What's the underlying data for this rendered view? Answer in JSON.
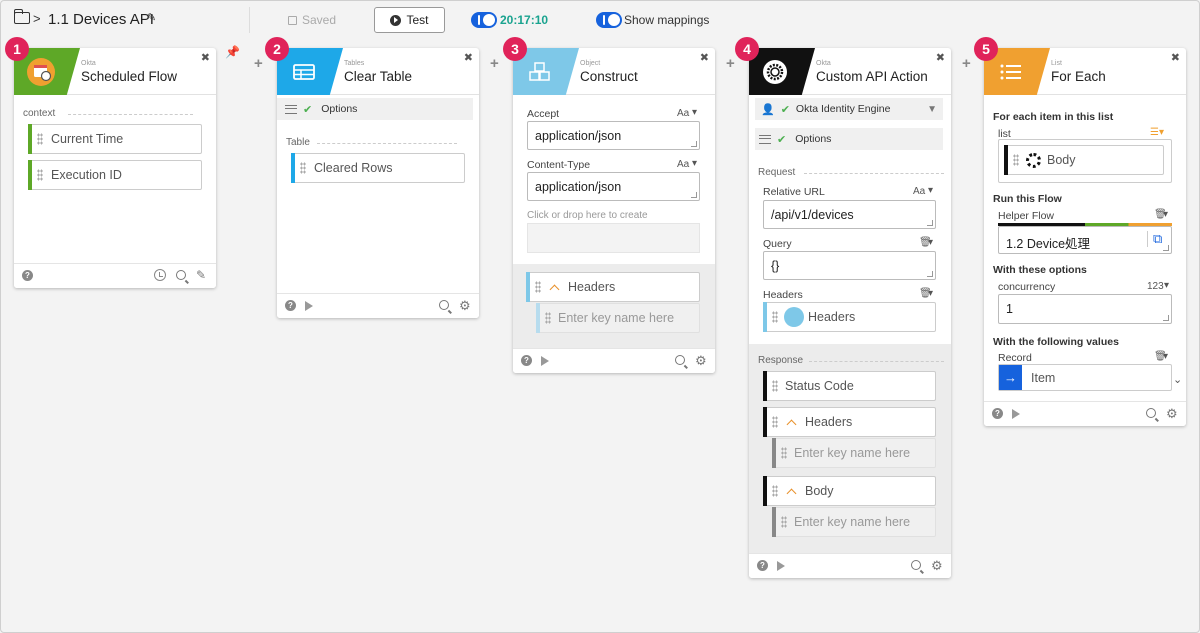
{
  "header": {
    "flow_name": "1.1 Devices API",
    "saved_label": "Saved",
    "test_label": "Test",
    "time": "20:17:10",
    "show_mappings_label": "Show mappings"
  },
  "colors": {
    "badge": "#e0235a",
    "okta_green": "#5ea827",
    "tables_blue": "#1ea8e8",
    "object_blue": "#7ec8e8",
    "okta_black": "#111111",
    "list_orange": "#f0a030",
    "time_teal": "#1aa38f",
    "toggle_blue": "#1662dd"
  },
  "cards": {
    "c1": {
      "step": "1",
      "category": "Okta",
      "title": "Scheduled Flow",
      "section_label": "context",
      "tokens": [
        "Current Time",
        "Execution ID"
      ],
      "icon": "calendar-clock-icon"
    },
    "c2": {
      "step": "2",
      "category": "Tables",
      "title": "Clear Table",
      "options_label": "Options",
      "section_label": "Table",
      "tokens": [
        "Cleared Rows"
      ],
      "icon": "table-icon"
    },
    "c3": {
      "step": "3",
      "category": "Object",
      "title": "Construct",
      "fields": [
        {
          "label": "Accept",
          "type": "Aa",
          "value": "application/json"
        },
        {
          "label": "Content-Type",
          "type": "Aa",
          "value": "application/json"
        }
      ],
      "drop_hint": "Click or drop here to create",
      "headers_label": "Headers",
      "key_placeholder": "Enter key name here",
      "icon": "cubes-icon"
    },
    "c4": {
      "step": "4",
      "category": "Okta",
      "title": "Custom API Action",
      "connection": "Okta Identity Engine",
      "options_label": "Options",
      "request_label": "Request",
      "fields": [
        {
          "label": "Relative URL",
          "type": "Aa",
          "value": "/api/v1/devices"
        },
        {
          "label": "Query",
          "value": "{}"
        }
      ],
      "headers_label": "Headers",
      "headers_token": "Headers",
      "response_label": "Response",
      "response_tokens": [
        "Status Code",
        "Headers",
        "Body"
      ],
      "key_placeholder": "Enter key name here",
      "icon": "okta-sun-icon"
    },
    "c5": {
      "step": "5",
      "category": "List",
      "title": "For Each",
      "section1": "For each item in this list",
      "list_label": "list",
      "list_token": "Body",
      "section2": "Run this Flow",
      "helper_label": "Helper Flow",
      "helper_value": "1.2 Device処理",
      "section3": "With these options",
      "concurrency_label": "concurrency",
      "concurrency_type": "123",
      "concurrency_value": "1",
      "section4": "With the following values",
      "record_label": "Record",
      "record_value": "Item",
      "icon": "list-icon"
    }
  }
}
